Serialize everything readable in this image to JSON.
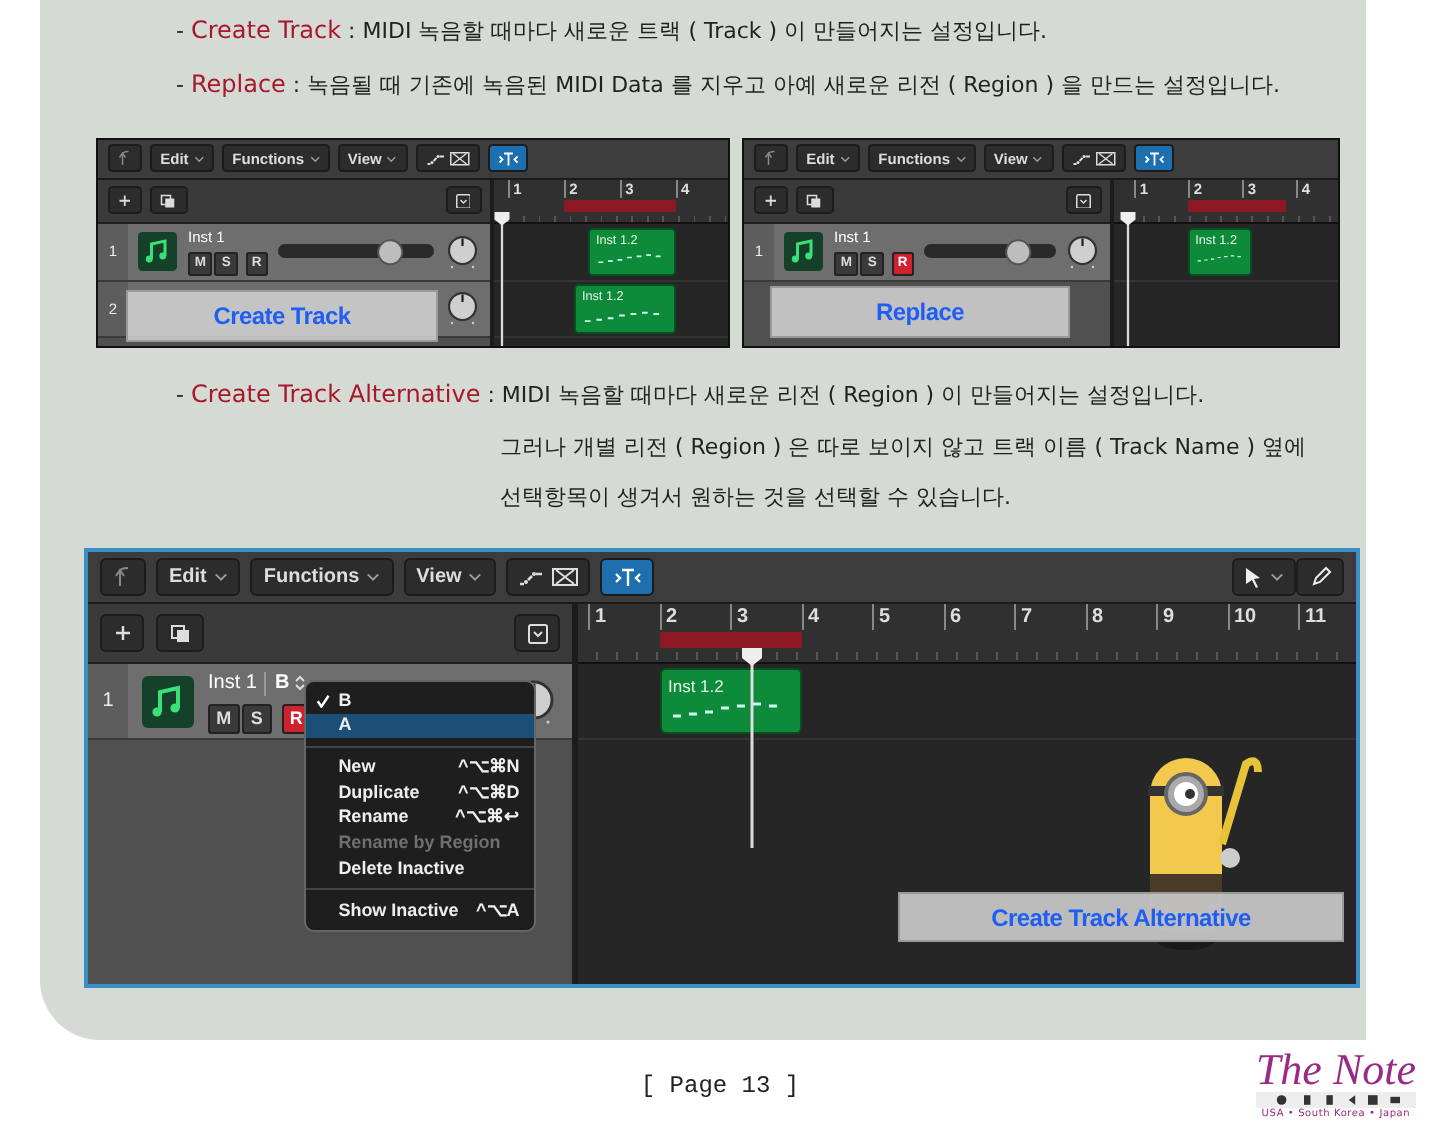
{
  "notes": [
    {
      "marker": "-",
      "term": "Create Track",
      "separator": ":",
      "text": "MIDI 녹음할 때마다 새로운 트랙 ( Track ) 이 만들어지는 설정입니다."
    },
    {
      "marker": "-",
      "term": "Replace",
      "separator": ":",
      "text": "녹음될 때 기존에 녹음된 MIDI Data 를 지우고 아예 새로운 리전 ( Region ) 을 만드는 설정입니다."
    }
  ],
  "examples": [
    {
      "menus": [
        "Edit",
        "Functions",
        "View"
      ],
      "bars": [
        "1",
        "2",
        "3",
        "4"
      ],
      "caption": "Create Track",
      "tracks": [
        {
          "number": "1",
          "name": "Inst 1",
          "mute_label": "M",
          "solo_label": "S",
          "record_label": "R",
          "record_armed": false,
          "volume": {
            "level": 0.72
          },
          "regions": [
            "Inst 1.2"
          ]
        },
        {
          "number": "2",
          "regions": [
            "Inst 1.2"
          ]
        }
      ]
    },
    {
      "menus": [
        "Edit",
        "Functions",
        "View"
      ],
      "bars": [
        "1",
        "2",
        "3",
        "4"
      ],
      "caption": "Replace",
      "tracks": [
        {
          "number": "1",
          "name": "Inst 1",
          "mute_label": "M",
          "solo_label": "S",
          "record_label": "R",
          "record_armed": true,
          "volume": {
            "level": 0.72
          },
          "regions": [
            "Inst 1.2"
          ]
        }
      ]
    }
  ],
  "alternative_note": {
    "marker": "-",
    "term": "Create Track Alternative",
    "separator": ":",
    "lines": [
      "MIDI 녹음할 때마다 새로운 리전 ( Region ) 이 만들어지는 설정입니다.",
      "그러나 개별 리전 ( Region ) 은 따로 보이지 않고 트랙 이름 ( Track Name ) 옆에",
      "선택항목이 생겨서 원하는 것을 선택할 수 있습니다."
    ]
  },
  "alternative_example": {
    "menus": [
      "Edit",
      "Functions",
      "View"
    ],
    "bars": [
      "1",
      "2",
      "3",
      "4",
      "5",
      "6",
      "7",
      "8",
      "9",
      "10",
      "11"
    ],
    "caption": "Create Track Alternative",
    "tracks": [
      {
        "number": "1",
        "name": "Inst 1",
        "alternative": "B",
        "mute_label": "M",
        "solo_label": "S",
        "record_label": "R",
        "record_armed": true,
        "regions": [
          "Inst 1.2"
        ]
      }
    ],
    "menu": {
      "groups": [
        [
          {
            "label": "B",
            "checked": true,
            "selected": false
          },
          {
            "label": "A",
            "checked": false,
            "selected": true
          }
        ],
        [
          {
            "label": "New",
            "shortcut": "^⌥⌘N",
            "disabled": false
          },
          {
            "label": "Duplicate",
            "shortcut": "^⌥⌘D",
            "disabled": false
          },
          {
            "label": "Rename",
            "shortcut": "^⌥⌘↩",
            "disabled": false
          },
          {
            "label": "Rename by Region",
            "disabled": true
          },
          {
            "label": "Delete Inactive",
            "disabled": false
          }
        ],
        [
          {
            "label": "Show Inactive",
            "shortcut": "^⌥A",
            "disabled": false
          }
        ]
      ]
    }
  },
  "footer": {
    "page": "[ Page 13 ]",
    "logo": {
      "title": "The Note",
      "tagline": "USA • South Korea • Japan"
    }
  }
}
